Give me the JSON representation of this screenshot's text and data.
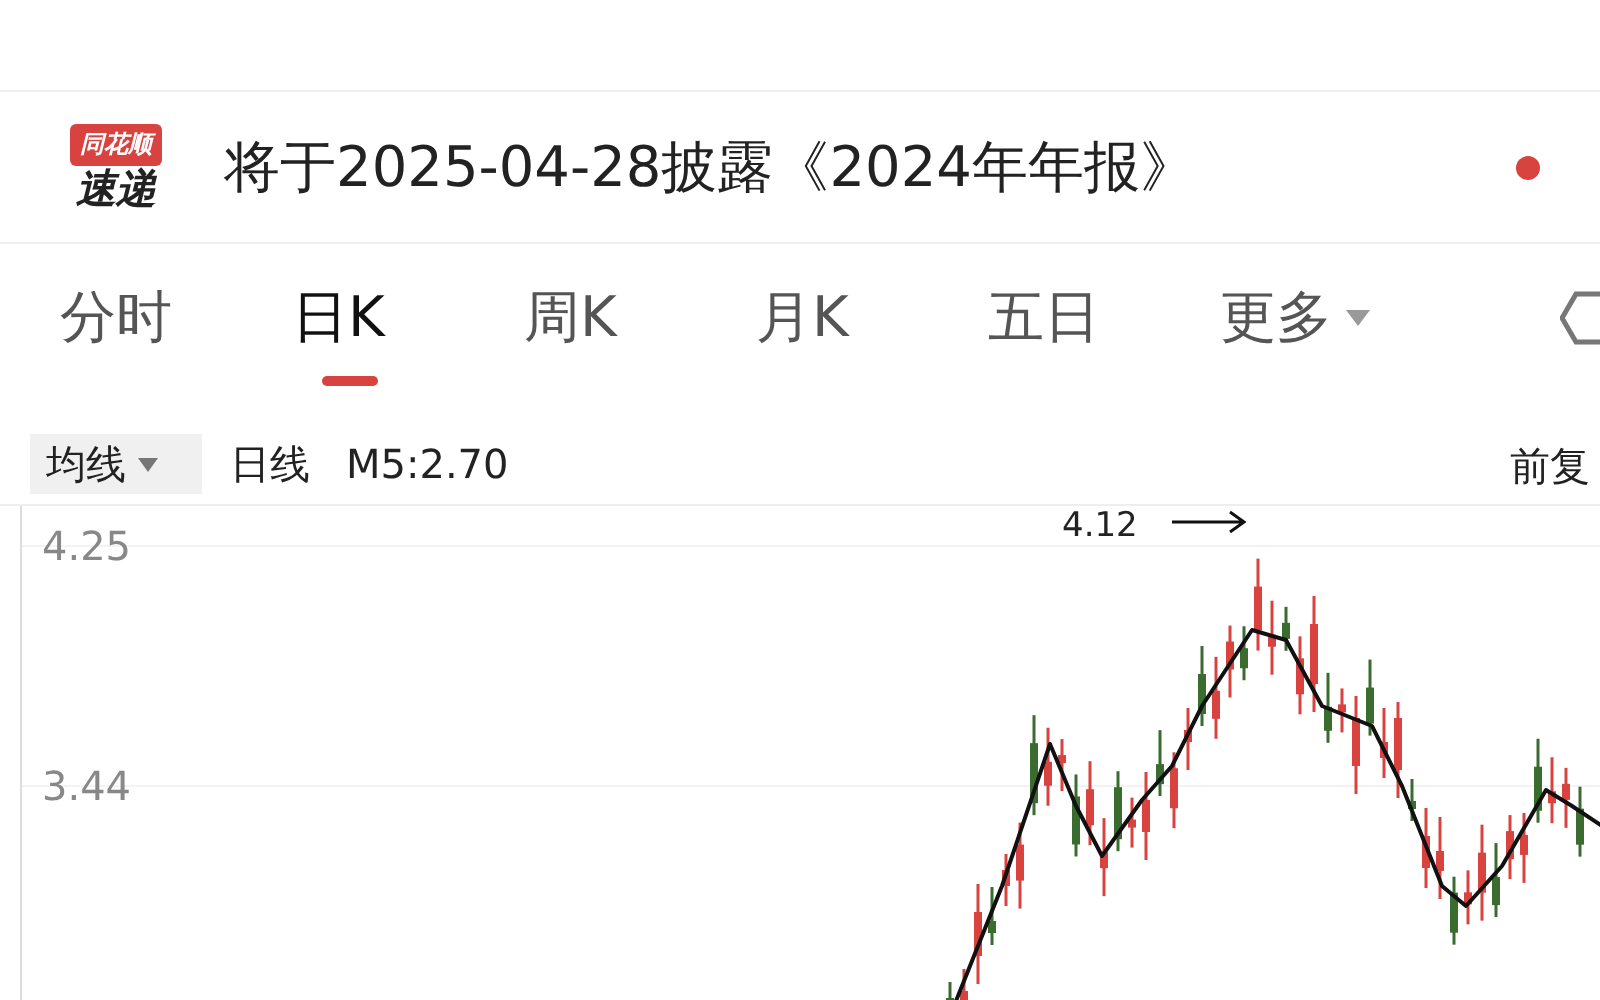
{
  "logo": {
    "line_1": "同花顺",
    "line_2": "速递"
  },
  "notice": {
    "text": "将于2025-04-28披露《2024年年报》",
    "unread": true
  },
  "tabs": [
    {
      "label": "分时",
      "selected": false,
      "kind": "plain"
    },
    {
      "label": "日K",
      "selected": true,
      "kind": "plain"
    },
    {
      "label": "周K",
      "selected": false,
      "kind": "plain"
    },
    {
      "label": "月K",
      "selected": false,
      "kind": "plain"
    },
    {
      "label": "五日",
      "selected": false,
      "kind": "plain"
    },
    {
      "label": "更多",
      "selected": false,
      "kind": "dropdown"
    }
  ],
  "indicator_bar": {
    "menu": "均线",
    "period": "日线",
    "reading": "M5:2.70",
    "adjust": "前复"
  },
  "chart": {
    "y_labels": [
      "4.25",
      "3.44"
    ],
    "peak_label": "4.12"
  }
}
